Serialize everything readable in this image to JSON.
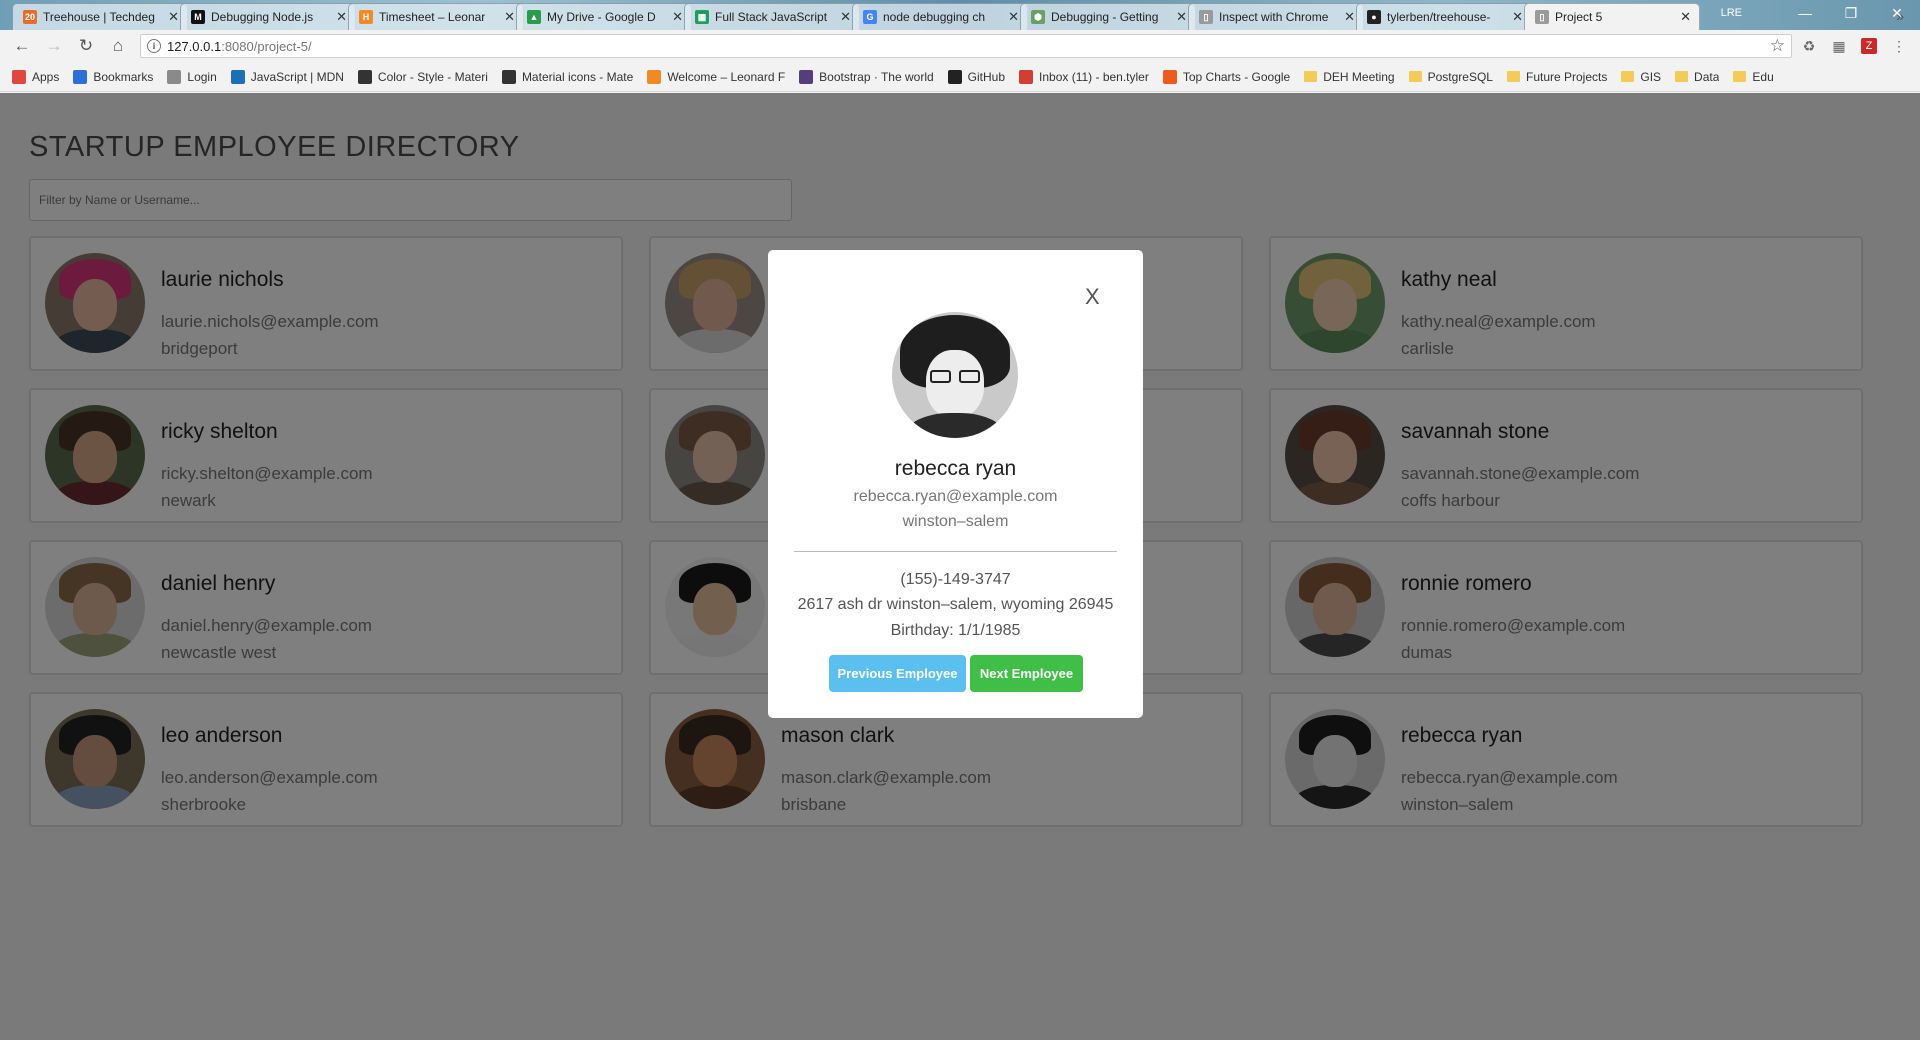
{
  "browser": {
    "tabs": [
      {
        "title": "Treehouse | Techdeg",
        "fav": "20",
        "color": "#e66c2c",
        "active": false
      },
      {
        "title": "Debugging Node.js",
        "fav": "M",
        "color": "#111111",
        "active": false
      },
      {
        "title": "Timesheet – Leonar",
        "fav": "H",
        "color": "#f08a24",
        "active": false
      },
      {
        "title": "My Drive - Google D",
        "fav": "▲",
        "color": "#2b9d4a",
        "active": false
      },
      {
        "title": "Full Stack JavaScript",
        "fav": "▦",
        "color": "#1e9e5a",
        "active": false
      },
      {
        "title": "node debugging ch",
        "fav": "G",
        "color": "#4285f4",
        "active": false
      },
      {
        "title": "Debugging - Getting",
        "fav": "⬢",
        "color": "#68a063",
        "active": false
      },
      {
        "title": "Inspect with Chrome",
        "fav": "▯",
        "color": "#9a9a9a",
        "active": false
      },
      {
        "title": "tylerben/treehouse-",
        "fav": "●",
        "color": "#222222",
        "active": false
      },
      {
        "title": "Project 5",
        "fav": "▯",
        "color": "#9a9a9a",
        "active": true
      }
    ],
    "profile": "LRE",
    "url_host": "127.0.0.1",
    "url_path": ":8080/project-5/",
    "bookmarks": [
      {
        "label": "Apps",
        "icon": "apps-icon",
        "color": "#e0473f"
      },
      {
        "label": "Bookmarks",
        "icon": "star-icon",
        "color": "#2d6fd6"
      },
      {
        "label": "Login",
        "icon": "lock-icon",
        "color": "#8a8a8a"
      },
      {
        "label": "JavaScript | MDN",
        "icon": "mdn-icon",
        "color": "#1b6fb4"
      },
      {
        "label": "Color - Style - Materi",
        "icon": "material-icon",
        "color": "#333333"
      },
      {
        "label": "Material icons - Mate",
        "icon": "material-icon",
        "color": "#333333"
      },
      {
        "label": "Welcome – Leonard F",
        "icon": "harvest-icon",
        "color": "#f08a24"
      },
      {
        "label": "Bootstrap · The world",
        "icon": "bootstrap-icon",
        "color": "#563d7c"
      },
      {
        "label": "GitHub",
        "icon": "github-icon",
        "color": "#222222"
      },
      {
        "label": "Inbox (11) - ben.tyler",
        "icon": "gmail-icon",
        "color": "#d23f31"
      },
      {
        "label": "Top Charts - Google",
        "icon": "music-icon",
        "color": "#ef5a1f"
      },
      {
        "label": "DEH Meeting",
        "icon": "folder-icon",
        "color": "#f3cc58"
      },
      {
        "label": "PostgreSQL",
        "icon": "folder-icon",
        "color": "#f3cc58"
      },
      {
        "label": "Future Projects",
        "icon": "folder-icon",
        "color": "#f3cc58"
      },
      {
        "label": "GIS",
        "icon": "folder-icon",
        "color": "#f3cc58"
      },
      {
        "label": "Data",
        "icon": "folder-icon",
        "color": "#f3cc58"
      },
      {
        "label": "Edu",
        "icon": "folder-icon",
        "color": "#f3cc58"
      }
    ],
    "bookmarks_more": "»"
  },
  "page": {
    "title": "STARTUP EMPLOYEE DIRECTORY",
    "filter_placeholder": "Filter by Name or Username..."
  },
  "employees": [
    {
      "name": "laurie nichols",
      "email": "laurie.nichols@example.com",
      "city": "bridgeport",
      "skin": "#e9b9a2",
      "hair": "#d8367a",
      "shirt": "#3c4a5a",
      "bg": "#8a7a6a"
    },
    {
      "name": "",
      "email": "",
      "city": "",
      "skin": "#e2b49a",
      "hair": "#c7a06b",
      "shirt": "#d8d8d8",
      "bg": "#9a8f86"
    },
    {
      "name": "kathy neal",
      "email": "kathy.neal@example.com",
      "city": "carlisle",
      "skin": "#f1ccb2",
      "hair": "#e5c27a",
      "shirt": "#5b8c5a",
      "bg": "#6f9a6a"
    },
    {
      "name": "ricky shelton",
      "email": "ricky.shelton@example.com",
      "city": "newark",
      "skin": "#d9a988",
      "hair": "#4a3426",
      "shirt": "#6a2a35",
      "bg": "#5a6b4f"
    },
    {
      "name": "",
      "email": "",
      "city": "",
      "skin": "#e8c3ad",
      "hair": "#7a5a45",
      "shirt": "#6b5a4a",
      "bg": "#8f8b85"
    },
    {
      "name": "savannah stone",
      "email": "savannah.stone@example.com",
      "city": "coffs harbour",
      "skin": "#f0c4ad",
      "hair": "#6a3d2a",
      "shirt": "#7b5a46",
      "bg": "#584c44"
    },
    {
      "name": "daniel henry",
      "email": "daniel.henry@example.com",
      "city": "newcastle west",
      "skin": "#dcb39b",
      "hair": "#8a6a48",
      "shirt": "#9aa37a",
      "bg": "#d9d9d9"
    },
    {
      "name": "",
      "email": "",
      "city": "",
      "skin": "#e6bf9a",
      "hair": "#1b1b1b",
      "shirt": "#ececec",
      "bg": "#f0f0f0"
    },
    {
      "name": "ronnie romero",
      "email": "ronnie.romero@example.com",
      "city": "dumas",
      "skin": "#e0b29a",
      "hair": "#8b5a3a",
      "shirt": "#4a4a4a",
      "bg": "#cfcfcf"
    },
    {
      "name": "leo anderson",
      "email": "leo.anderson@example.com",
      "city": "sherbrooke",
      "skin": "#c99b7c",
      "hair": "#222222",
      "shirt": "#8aa2c2",
      "bg": "#7b6f58"
    },
    {
      "name": "mason clark",
      "email": "mason.clark@example.com",
      "city": "brisbane",
      "skin": "#c9885f",
      "hair": "#3b2a20",
      "shirt": "#5a3a2a",
      "bg": "#8a5f40"
    },
    {
      "name": "rebecca ryan",
      "email": "rebecca.ryan@example.com",
      "city": "winston–salem",
      "skin": "#e6e6e6",
      "hair": "#1e1e1e",
      "shirt": "#2a2a2a",
      "bg": "#d5d5d5"
    }
  ],
  "modal": {
    "close_label": "X",
    "name": "rebecca ryan",
    "email": "rebecca.ryan@example.com",
    "city": "winston–salem",
    "phone": "(155)-149-3747",
    "address": "2617 ash dr winston–salem, wyoming 26945",
    "birthday": "Birthday: 1/1/1985",
    "prev_label": "Previous Employee",
    "next_label": "Next Employee",
    "prev_color": "#5bc0f0",
    "next_color": "#3fbf47"
  }
}
